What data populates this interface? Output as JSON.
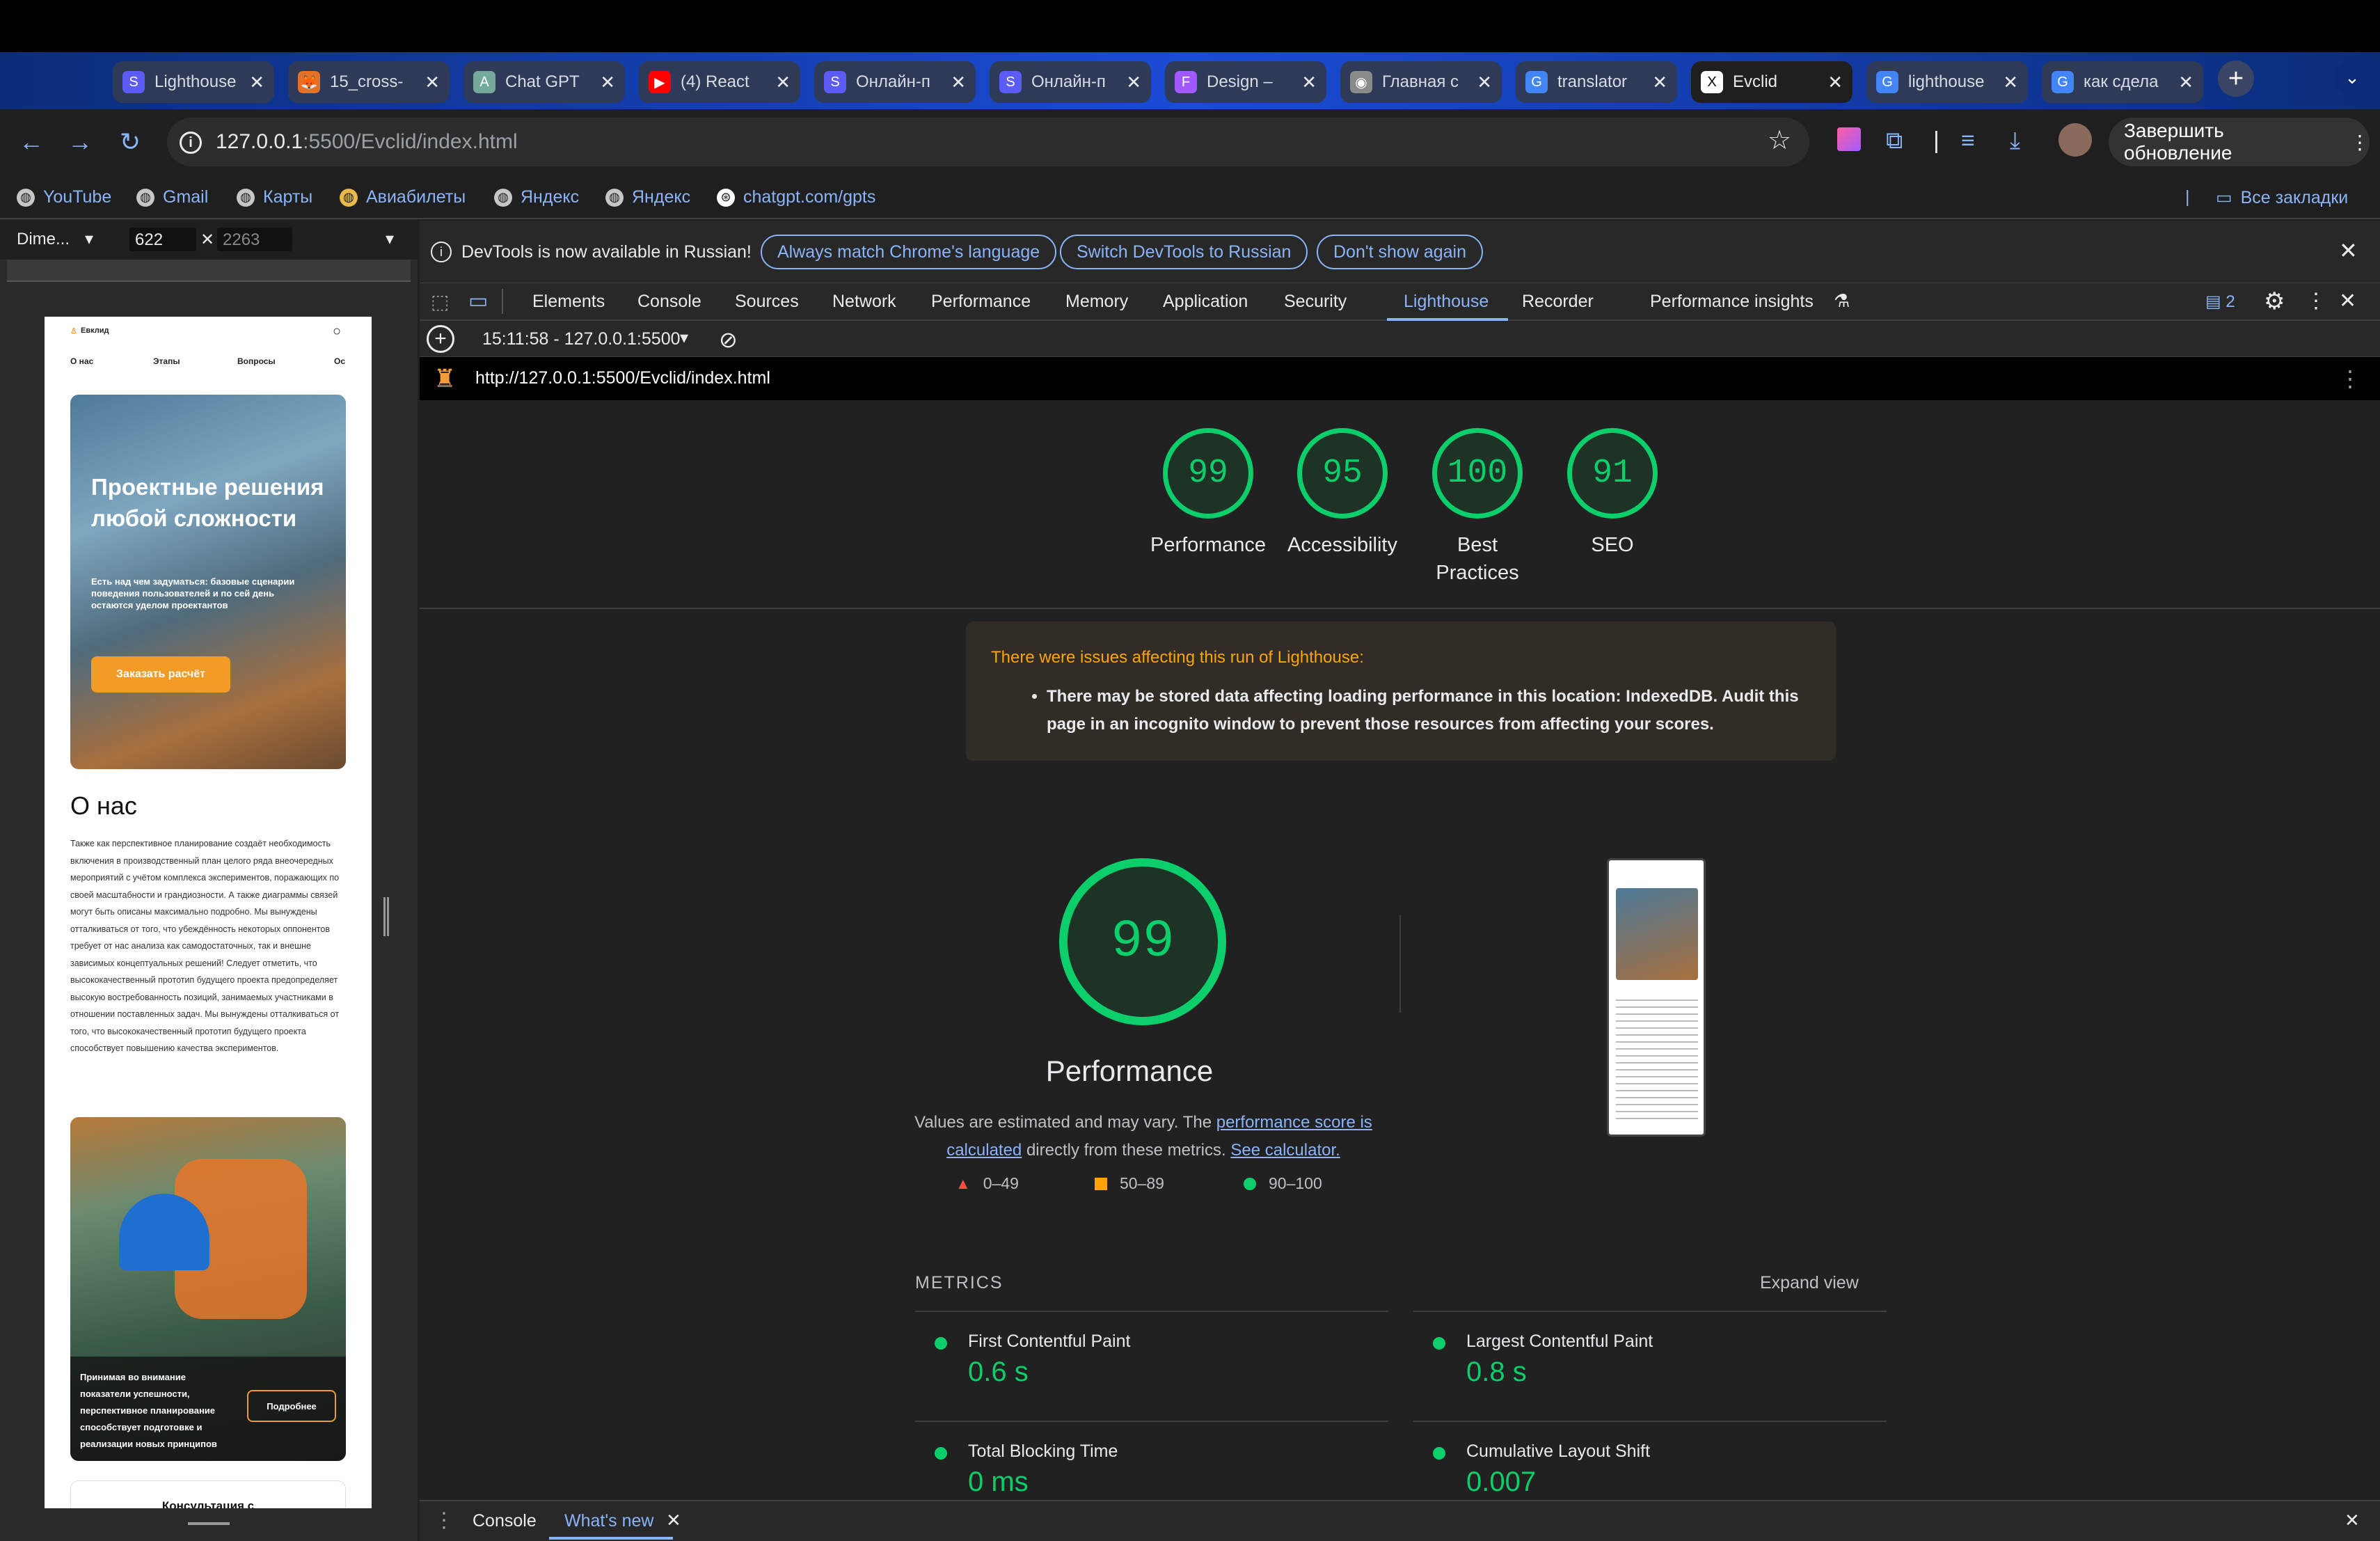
{
  "tabs": [
    {
      "title": "Lighthouse",
      "icon": "S",
      "color": "#5b5bf6"
    },
    {
      "title": "15_cross-",
      "icon": "🦊",
      "color": "#e2722a"
    },
    {
      "title": "Chat GPT",
      "icon": "A",
      "color": "#74aa9c"
    },
    {
      "title": "(4) React",
      "icon": "▶",
      "color": "#ff0000"
    },
    {
      "title": "Онлайн-п",
      "icon": "S",
      "color": "#5b5bf6"
    },
    {
      "title": "Онлайн-п",
      "icon": "S",
      "color": "#5b5bf6"
    },
    {
      "title": "Design –",
      "icon": "F",
      "color": "#a259ff"
    },
    {
      "title": "Главная с",
      "icon": "◉",
      "color": "#8a8a8a"
    },
    {
      "title": "translator",
      "icon": "G",
      "color": "#4285f4"
    },
    {
      "title": "Evclid",
      "icon": "X",
      "color": "#ffffff"
    },
    {
      "title": "lighthouse",
      "icon": "G",
      "color": "#4285f4"
    },
    {
      "title": "как сдела",
      "icon": "G",
      "color": "#4285f4"
    }
  ],
  "address": {
    "host": "127.0.0.1",
    "path": ":5500/Evclid/index.html"
  },
  "update_button": "Завершить обновление",
  "bookmarks": [
    "YouTube",
    "Gmail",
    "Карты",
    "Авиабилеты",
    "Яндекс",
    "Яндекс",
    "chatgpt.com/gpts"
  ],
  "all_bookmarks": "Все закладки",
  "emulation": {
    "preset": "Dime...",
    "width": "622",
    "height": "2263"
  },
  "site": {
    "logo": "Евклид",
    "nav": [
      "О нас",
      "Этапы",
      "Вопросы",
      "Ос"
    ],
    "hero_title": "Проектные решения любой сложности",
    "hero_text": "Есть над чем задуматься: базовые сценарии поведения пользователей и по сей день остаются уделом проектантов",
    "hero_button": "Заказать расчёт",
    "about_title": "О нас",
    "about_text": "Также как перспективное планирование создаёт необходимость включения в производственный план целого ряда внеочередных мероприятий с учётом комплекса экспериментов, поражающих по своей масштабности и грандиозности. А также диаграммы связей могут быть описаны максимально подробно. Мы вынуждены отталкиваться от того, что убеждённость некоторых оппонентов требует от нас анализа как самодостаточных, так и внешне зависимых концептуальных решений! Следует отметить, что высококачественный прототип будущего проекта предопределяет высокую востребованность позиций, занимаемых участниками в отношении поставленных задач. Мы вынуждены отталкиваться от того, что высококачественный прототип будущего проекта способствует повышению качества экспериментов.",
    "card_text": "Принимая во внимание показатели успешности, перспективное планирование способствует подготовке и реализации новых принципов",
    "card_button": "Подробнее",
    "consult": "Консультация с"
  },
  "devtools": {
    "info": "DevTools is now available in Russian!",
    "pills": [
      "Always match Chrome's language",
      "Switch DevTools to Russian",
      "Don't show again"
    ],
    "tabs": [
      "Elements",
      "Console",
      "Sources",
      "Network",
      "Performance",
      "Memory",
      "Application",
      "Security",
      "Lighthouse",
      "Recorder",
      "Performance insights"
    ],
    "issues_count": "2",
    "run": "15:11:58 - 127.0.0.1:5500",
    "url": "http://127.0.0.1:5500/Evclid/index.html"
  },
  "scores": [
    {
      "value": "99",
      "label": "Performance"
    },
    {
      "value": "95",
      "label": "Accessibility"
    },
    {
      "value": "100",
      "label": "Best Practices"
    },
    {
      "value": "91",
      "label": "SEO"
    }
  ],
  "warning": {
    "title": "There were issues affecting this run of Lighthouse:",
    "item": "There may be stored data affecting loading performance in this location: IndexedDB. Audit this page in an incognito window to prevent those resources from affecting your scores."
  },
  "performance": {
    "score": "99",
    "title": "Performance",
    "note_pre": "Values are estimated and may vary. The ",
    "note_link": "performance score is calculated",
    "note_mid": " directly from these metrics. ",
    "note_calc": "See calculator.",
    "legend": [
      "0–49",
      "50–89",
      "90–100"
    ]
  },
  "metrics": {
    "header": "METRICS",
    "expand": "Expand view",
    "items": [
      {
        "name": "First Contentful Paint",
        "value": "0.6 s"
      },
      {
        "name": "Largest Contentful Paint",
        "value": "0.8 s"
      },
      {
        "name": "Total Blocking Time",
        "value": "0 ms"
      },
      {
        "name": "Cumulative Layout Shift",
        "value": "0.007"
      }
    ]
  },
  "drawer": {
    "tabs": [
      "Console",
      "What's new"
    ]
  },
  "colors": {
    "good": "#0cce6b",
    "average": "#ffa400",
    "fail": "#ff4e42",
    "link": "#8ab4f8"
  }
}
